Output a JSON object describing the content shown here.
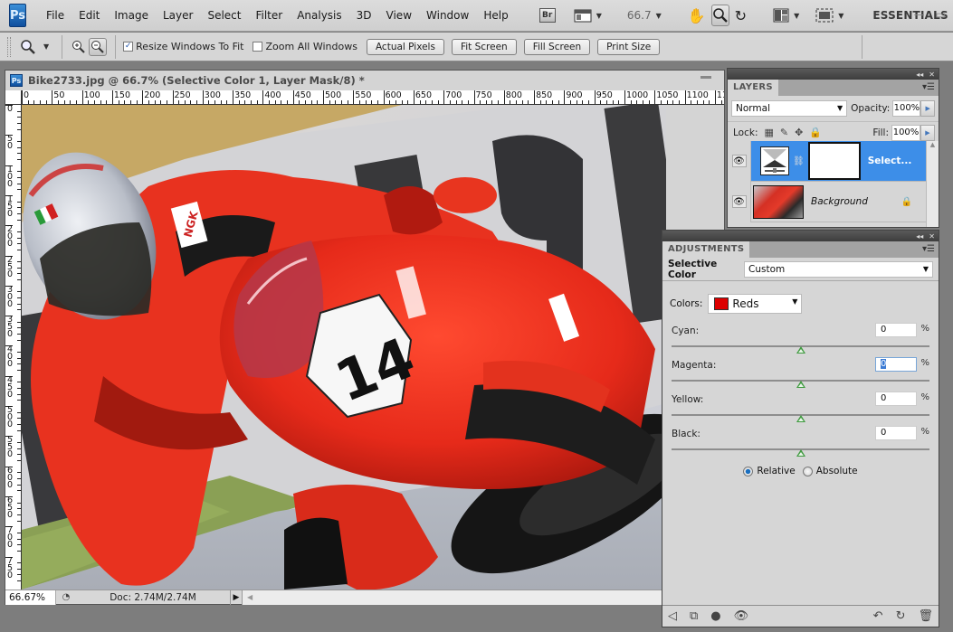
{
  "app": {
    "logo": "Ps",
    "menu": [
      "File",
      "Edit",
      "Image",
      "Layer",
      "Select",
      "Filter",
      "Analysis",
      "3D",
      "View",
      "Window",
      "Help"
    ],
    "bridge_label": "Br",
    "zoom_level": "66.7",
    "workspace": "ESSENTIALS",
    "icons": [
      "bridge-icon",
      "screen-mode-icon",
      "hand-icon",
      "zoom-icon",
      "rotate-view-icon",
      "arrange-documents-icon",
      "screen-mode-toggle-icon"
    ]
  },
  "options": {
    "resize_windows": {
      "label": "Resize Windows To Fit",
      "checked": true
    },
    "zoom_all": {
      "label": "Zoom All Windows",
      "checked": false
    },
    "buttons": [
      "Actual Pixels",
      "Fit Screen",
      "Fill Screen",
      "Print Size"
    ]
  },
  "document": {
    "title": "Bike2733.jpg @ 66.7% (Selective Color 1, Layer Mask/8) *",
    "ruler_top": [
      "0",
      "50",
      "100",
      "150",
      "200",
      "250",
      "300",
      "350",
      "400",
      "450",
      "500",
      "550",
      "600",
      "650",
      "700",
      "750",
      "800",
      "850",
      "900",
      "950",
      "1000",
      "1050",
      "1100",
      "11"
    ],
    "ruler_left": [
      "0",
      "50",
      "100",
      "150",
      "200",
      "250",
      "300",
      "350",
      "400",
      "450",
      "500",
      "550",
      "600",
      "650",
      "700",
      "750"
    ],
    "status": {
      "zoom": "66.67%",
      "doc_size": "Doc: 2.74M/2.74M"
    }
  },
  "layers_panel": {
    "tab": "LAYERS",
    "blend_mode": "Normal",
    "opacity_label": "Opacity:",
    "opacity": "100%",
    "lock_label": "Lock:",
    "fill_label": "Fill:",
    "fill": "100%",
    "layers": [
      {
        "name": "Select...",
        "type": "adjustment",
        "selected": true,
        "visible": true
      },
      {
        "name": "Background",
        "type": "image",
        "selected": false,
        "visible": true,
        "locked": true
      }
    ]
  },
  "adjustments_panel": {
    "tab": "ADJUSTMENTS",
    "type_label": "Selective Color",
    "preset": "Custom",
    "colors_label": "Colors:",
    "colors_value": "Reds",
    "colors_swatch": "#dd0000",
    "sliders": [
      {
        "label": "Cyan:",
        "value": "0",
        "unit": "%",
        "focused": false
      },
      {
        "label": "Magenta:",
        "value": "0",
        "unit": "%",
        "focused": true
      },
      {
        "label": "Yellow:",
        "value": "0",
        "unit": "%",
        "focused": false
      },
      {
        "label": "Black:",
        "value": "0",
        "unit": "%",
        "focused": false
      }
    ],
    "method": {
      "relative": {
        "label": "Relative",
        "checked": true
      },
      "absolute": {
        "label": "Absolute",
        "checked": false
      }
    }
  }
}
